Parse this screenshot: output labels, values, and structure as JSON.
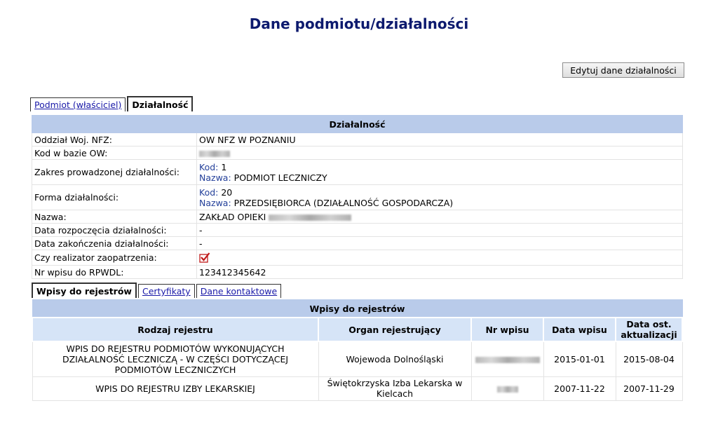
{
  "page_title": "Dane podmiotu/działalności",
  "edit_button": "Edytuj dane działalności",
  "tabs_top": [
    {
      "label": "Podmiot (właściciel)",
      "active": false
    },
    {
      "label": "Działalność",
      "active": true
    }
  ],
  "activity": {
    "header": "Działalność",
    "rows": {
      "oddzial_label": "Oddział Woj. NFZ:",
      "oddzial_value": "OW NFZ W POZNANIU",
      "kod_ow_label": "Kod w bazie OW:",
      "zakres_label": "Zakres prowadzonej działalności:",
      "zakres_kod_key": "Kod:",
      "zakres_kod_value": "1",
      "zakres_nazwa_key": "Nazwa:",
      "zakres_nazwa_value": "PODMIOT LECZNICZY",
      "forma_label": "Forma działalności:",
      "forma_kod_key": "Kod:",
      "forma_kod_value": "20",
      "forma_nazwa_key": "Nazwa:",
      "forma_nazwa_value": "PRZEDSIĘBIORCA (DZIAŁALNOŚĆ GOSPODARCZA)",
      "nazwa_label": "Nazwa:",
      "nazwa_value": "ZAKŁAD OPIEKI",
      "data_rozp_label": "Data rozpoczęcia działalności:",
      "data_rozp_value": "-",
      "data_zak_label": "Data zakończenia działalności:",
      "data_zak_value": "-",
      "realizator_label": "Czy realizator zaopatrzenia:",
      "realizator_checked": true,
      "rpwdl_label": "Nr wpisu do RPWDL:",
      "rpwdl_value": "123412345642"
    }
  },
  "tabs_bottom": [
    {
      "label": "Wpisy do rejestrów",
      "active": true
    },
    {
      "label": "Certyfikaty",
      "active": false
    },
    {
      "label": "Dane kontaktowe",
      "active": false
    }
  ],
  "registers": {
    "header": "Wpisy do rejestrów",
    "columns": [
      "Rodzaj rejestru",
      "Organ rejestrujący",
      "Nr wpisu",
      "Data wpisu",
      "Data ost. aktualizacji"
    ],
    "rows": [
      {
        "rodzaj": "WPIS DO REJESTRU PODMIOTÓW WYKONUJĄCYCH DZIAŁALNOŚĆ LECZNICZĄ - W CZĘŚCI DOTYCZĄCEJ PODMIOTÓW LECZNICZYCH",
        "organ": "Wojewoda Dolnośląski",
        "data_wpisu": "2015-01-01",
        "data_akt": "2015-08-04"
      },
      {
        "rodzaj": "WPIS DO REJESTRU IZBY LEKARSKIEJ",
        "organ": "Świętokrzyska Izba Lekarska w Kielcach",
        "data_wpisu": "2007-11-22",
        "data_akt": "2007-11-29"
      }
    ]
  }
}
